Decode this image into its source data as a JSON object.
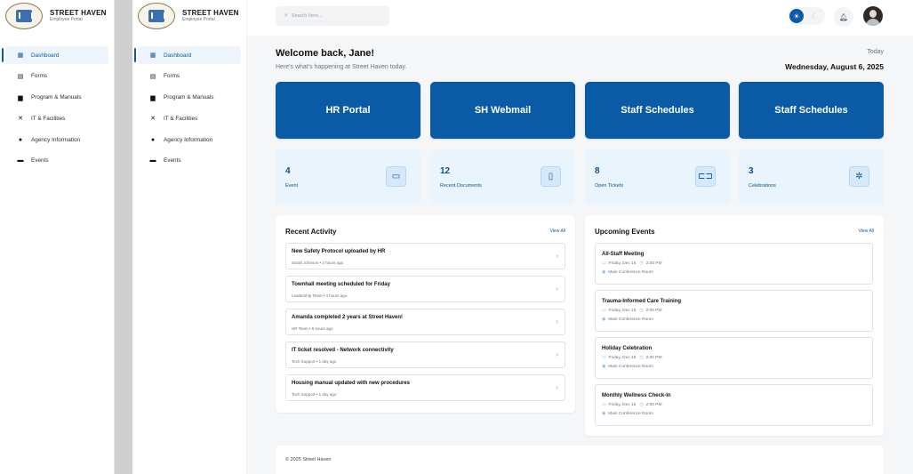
{
  "brand": {
    "name": "STREET HAVEN",
    "subtitle": "Employee Portal"
  },
  "sidebar": {
    "items": [
      {
        "label": "Dashboard",
        "icon": "grid-icon",
        "active": true
      },
      {
        "label": "Forms",
        "icon": "form-icon",
        "active": false
      },
      {
        "label": "Program & Manuals",
        "icon": "document-icon",
        "active": false
      },
      {
        "label": "IT & Facilities",
        "icon": "tools-icon",
        "active": false
      },
      {
        "label": "Agency Information",
        "icon": "info-icon",
        "active": false
      },
      {
        "label": "Events",
        "icon": "calendar-icon",
        "active": false
      }
    ]
  },
  "topbar": {
    "search_placeholder": "Search here...",
    "theme": "light"
  },
  "welcome": {
    "title": "Welcome back, Jane!",
    "subtitle": "Here's what's happening at Street Haven today.",
    "today_label": "Today",
    "date": "Wednesday, August 6, 2025"
  },
  "quick_links": [
    {
      "label": "HR Portal"
    },
    {
      "label": "SH Webmail"
    },
    {
      "label": "Staff Schedules"
    },
    {
      "label": "Staff Schedules"
    }
  ],
  "stats": [
    {
      "value": "4",
      "label": "Event",
      "icon": "calendar-icon"
    },
    {
      "value": "12",
      "label": "Recent Documents",
      "icon": "document-icon"
    },
    {
      "value": "8",
      "label": "Open Tickets",
      "icon": "ticket-icon"
    },
    {
      "value": "3",
      "label": "Celebrations",
      "icon": "party-icon"
    }
  ],
  "recent_activity": {
    "title": "Recent Activity",
    "view_all": "View All",
    "items": [
      {
        "title": "New Safety Protocol uploaded by HR",
        "meta": "Sarah Johnson  •  2 hours ago"
      },
      {
        "title": "Townhall meeting scheduled for Friday",
        "meta": "Leadership Team  •  4 hours ago"
      },
      {
        "title": "Amanda completed 2 years at Street Haven!",
        "meta": "HR Team  •  6 hours ago"
      },
      {
        "title": "IT ticket resolved - Network connectivity",
        "meta": "Tech Support  •  1 day ago"
      },
      {
        "title": "Housing manual updated with new procedures",
        "meta": "Tech Support  •  1 day ago"
      }
    ]
  },
  "upcoming_events": {
    "title": "Upcoming Events",
    "view_all": "View All",
    "items": [
      {
        "title": "All-Staff Meeting",
        "date": "Friday, Dec 15",
        "time": "2:00 PM",
        "location": "Main Conference Room"
      },
      {
        "title": "Trauma-Informed Care Training",
        "date": "Friday, Dec 15",
        "time": "2:00 PM",
        "location": "Main Conference Room"
      },
      {
        "title": "Holiday Celebration",
        "date": "Friday, Dec 15",
        "time": "2:00 PM",
        "location": "Main Conference Room"
      },
      {
        "title": "Monthly Wellness Check-In",
        "date": "Friday, Dec 15",
        "time": "2:00 PM",
        "location": "Main Conference Room"
      }
    ]
  },
  "footer": {
    "text": "© 2025 Street Haven"
  },
  "colors": {
    "primary": "#0b5aa6",
    "stat_bg": "#eaf4fd",
    "main_bg": "#f5f6f8"
  }
}
